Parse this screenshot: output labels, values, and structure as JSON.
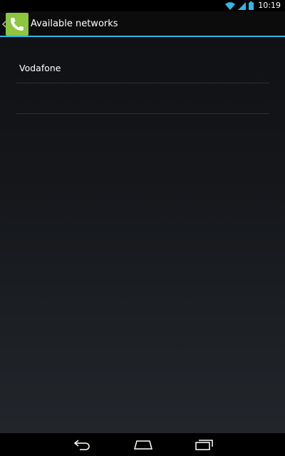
{
  "status_bar": {
    "time": "10:19",
    "icons": [
      "wifi-icon",
      "signal-icon",
      "battery-icon"
    ]
  },
  "action_bar": {
    "title": "Available networks",
    "app_icon": "phone-icon",
    "up_icon": "chevron-left-icon",
    "accent_color": "#33b5e5",
    "icon_bg_color": "#8dc63f"
  },
  "networks": [
    {
      "label": "Vodafone"
    },
    {
      "label": ""
    }
  ],
  "nav_bar": {
    "icons": [
      "back-icon",
      "home-icon",
      "recent-apps-icon"
    ]
  }
}
